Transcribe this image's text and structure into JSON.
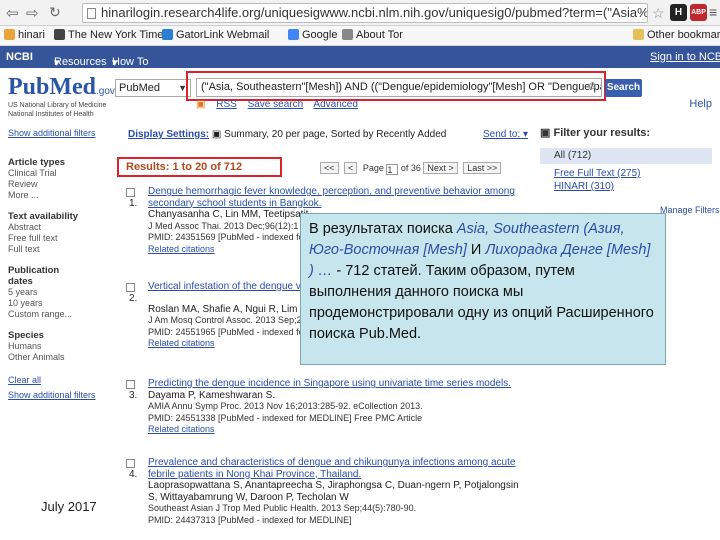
{
  "browser": {
    "url": "hinarilogin.research4life.org/uniquesigwww.ncbi.nlm.nih.gov/uniquesig0/pubmed?term=(\"Asia%",
    "ext_badges": [
      "H",
      "ABP"
    ],
    "bookmarks": [
      "hinari",
      "The New York Times",
      "GatorLink Webmail",
      "Google",
      "About Tor"
    ],
    "other_bookmarks": "Other bookmarks"
  },
  "ncbi_bar": {
    "brand": "NCBI",
    "resources": "Resources",
    "howto": "How To",
    "signin": "Sign in to NCBI"
  },
  "header": {
    "logo_pub": "Pub",
    "logo_med": "Med",
    "logo_gov": ".gov",
    "logo_sub1": "US National Library of Medicine",
    "logo_sub2": "National Institutes of Health",
    "db_value": "PubMed",
    "search_value": "(\"Asia, Southeastern\"[Mesh]) AND ((\"Dengue/epidemiology\"[Mesh] OR \"Dengue/pat",
    "search_button": "Search",
    "rss": "RSS",
    "save_search": "Save search",
    "advanced": "Advanced",
    "help": "Help"
  },
  "left_filters": {
    "show_additional": "Show additional filters",
    "article_types_hd": "Article types",
    "article_types": [
      "Clinical Trial",
      "Review",
      "More ..."
    ],
    "text_avail_hd": "Text availability",
    "text_avail": [
      "Abstract",
      "Free full text",
      "Full text"
    ],
    "pub_dates_hd": "Publication dates",
    "pub_dates": [
      "5 years",
      "10 years",
      "Custom range..."
    ],
    "species_hd": "Species",
    "species": [
      "Humans",
      "Other Animals"
    ],
    "clear_all": "Clear all",
    "show_additional2": "Show additional filters"
  },
  "results_bar": {
    "display_label": "Display Settings:",
    "display_value": "Summary, 20 per page, Sorted by Recently Added",
    "send_to": "Send to:",
    "count": "Results: 1 to 20 of 712",
    "page_label": "Page",
    "page_value": "1",
    "of_pages": "of 36",
    "next": "Next >",
    "last": "Last >>"
  },
  "results": [
    {
      "num": "1.",
      "title": "Dengue hemorrhagic fever knowledge, perception, and preventive behavior among secondary school students in Bangkok.",
      "authors": "Chanyasanha C, Lin MM, Teetipsatit",
      "journal": "J Med Assoc Thai. 2013 Dec;96(12):1",
      "ids": "PMID: 24351569 [PubMed - indexed for",
      "related": "Related citations"
    },
    {
      "num": "2.",
      "title": "Vertical infestation of the dengue vector",
      "authors": "Roslan MA, Shafie A, Ngui R, Lim Y",
      "journal": "J Am Mosq Control Assoc. 2013 Sep;29(4)",
      "ids": "PMID: 24551965 [PubMed - indexed for",
      "related": "Related citations"
    },
    {
      "num": "3.",
      "title": "Predicting the dengue incidence in Singapore using univariate time series models.",
      "authors": "Dayama P, Kameshwaran S.",
      "journal": "AMIA Annu Symp Proc. 2013 Nov 16;2013:285-92. eCollection 2013.",
      "ids": "PMID: 24551338 [PubMed - indexed for MEDLINE]    Free PMC Article",
      "related": "Related citations"
    },
    {
      "num": "4.",
      "title": "Prevalence and characteristics of dengue and chikungunya infections among acute febrile patients in Nong Khai Province, Thailand.",
      "authors": "Laoprasopwattana S, Anantapreecha S, Jiraphongsa C, Duan-ngern P, Potjalongsin S, Wittayabamrung W, Daroon P, Techolan W",
      "journal": "Southeast Asian J Trop Med Public Health. 2013 Sep;44(5):780-90.",
      "ids": "PMID: 24437313 [PubMed - indexed for MEDLINE]",
      "related": ""
    }
  ],
  "right_filters": {
    "heading": "Filter your results:",
    "all": "All (712)",
    "free_full": "Free Full Text (275)",
    "hinari": "HINARI (310)",
    "manage": "Manage Filters"
  },
  "callout": {
    "line1_prefix": "В результатах поиска ",
    "line1_italic": "Asia, Southeastern (Азия, Юго-Восточная [Mesh]",
    "line1_mid": " И ",
    "line1_italic2": "Лихорадка Денге [Mesh] ) …",
    "line1_suffix": " - 712 статей. Таким образом, путем выполнения данного поиска мы продемонстрировали одну из опций Расширенного поиска Pub.Med."
  },
  "footer_date": "July 2017"
}
